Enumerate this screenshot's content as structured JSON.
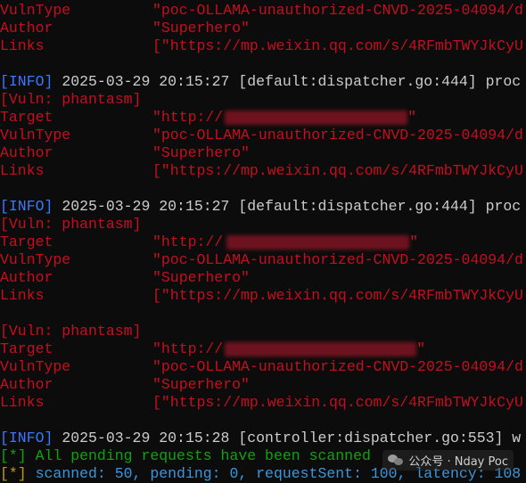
{
  "labels": {
    "vulntype": "VulnType",
    "author": "Author",
    "links": "Links",
    "target": "Target",
    "info": "[INFO]",
    "vuln": "[Vuln: phantasm]"
  },
  "values": {
    "vulntype": "\"poc-OLLAMA-unauthorized-CNVD-2025-04094/d",
    "author": "\"Superhero\"",
    "links": "[\"https://mp.weixin.qq.com/s/4RFmbTWYJkCyU",
    "target_prefix": "\"http://",
    "target_suffix": "\""
  },
  "info_lines": {
    "line1": " 2025-03-29 20:15:27 [default:dispatcher.go:444] proc",
    "line2": " 2025-03-29 20:15:27 [default:dispatcher.go:444] proc",
    "line3": " 2025-03-29 20:15:28 [controller:dispatcher.go:553] w"
  },
  "status": {
    "star": "[*]",
    "pending_text": " All pending requests have been scanned",
    "scanned_text": " scanned: 50, pending: 0, requestSent: 100, latency: 108"
  },
  "watermark": {
    "icon": "wechat-icon",
    "text": "公众号 · Nday Poc"
  },
  "colors": {
    "background": "#0c0c0c",
    "red": "#c50f1f",
    "blue": "#3b78ff",
    "gray": "#cccccc",
    "green": "#13a10e",
    "yellow": "#c19c00",
    "cyan": "#3a96dd"
  }
}
